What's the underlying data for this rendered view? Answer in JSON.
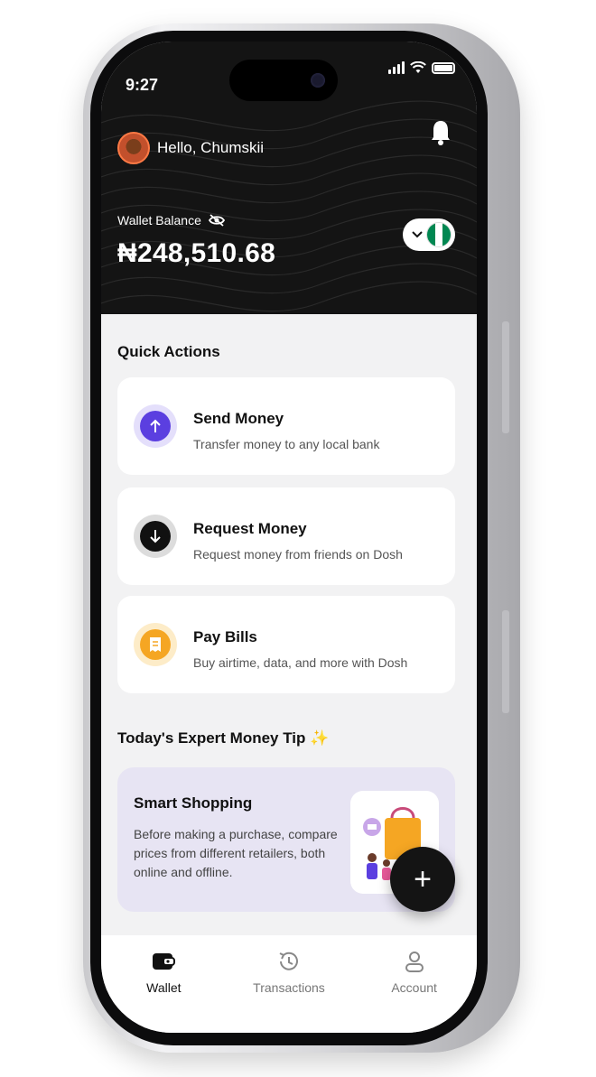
{
  "status_bar": {
    "time": "9:27"
  },
  "header": {
    "greeting": "Hello, Chumskii",
    "balance_label": "Wallet Balance",
    "balance_value": "₦248,510.68"
  },
  "quick_actions": {
    "title": "Quick Actions",
    "items": [
      {
        "title": "Send Money",
        "subtitle": "Transfer money to any local bank",
        "icon": "arrow-up-icon",
        "color": "#5b3fe0"
      },
      {
        "title": "Request Money",
        "subtitle": "Request money from friends on Dosh",
        "icon": "arrow-down-icon",
        "color": "#111111"
      },
      {
        "title": "Pay Bills",
        "subtitle": "Buy airtime, data, and more with Dosh",
        "icon": "receipt-icon",
        "color": "#f5a623"
      }
    ]
  },
  "tip": {
    "section_title": "Today's Expert Money Tip ✨",
    "title": "Smart Shopping",
    "body": "Before making a purchase, compare prices from different retailers, both online and offline."
  },
  "fab": {
    "label": "+"
  },
  "bottom_nav": {
    "items": [
      {
        "label": "Wallet",
        "icon": "wallet-icon",
        "active": true
      },
      {
        "label": "Transactions",
        "icon": "history-icon",
        "active": false
      },
      {
        "label": "Account",
        "icon": "user-icon",
        "active": false
      }
    ]
  }
}
